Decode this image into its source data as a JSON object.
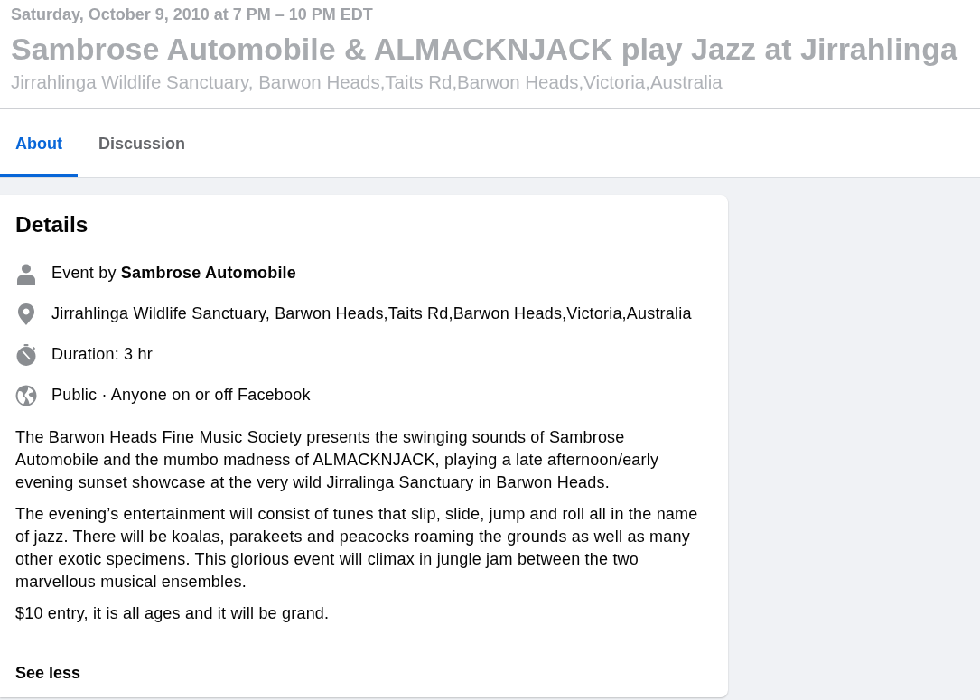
{
  "event_header": {
    "date": "Saturday, October 9, 2010 at 7 PM – 10 PM EDT",
    "title": "Sambrose Automobile & ALMACKNJACK play Jazz at Jirrahlinga",
    "location": "Jirrahlinga Wildlife Sanctuary, Barwon Heads,Taits Rd,Barwon Heads,Victoria,Australia"
  },
  "tabs": [
    {
      "label": "About",
      "selected": true
    },
    {
      "label": "Discussion",
      "selected": false
    }
  ],
  "details": {
    "heading": "Details",
    "items": [
      {
        "kind": "host",
        "text": "Event by **Sambrose Automobile**"
      },
      {
        "kind": "location",
        "text": "Jirrahlinga Wildlife Sanctuary, Barwon Heads,Taits Rd,Barwon Heads,Victoria,Australia"
      },
      {
        "kind": "duration",
        "text": "Duration: 3 hr"
      },
      {
        "kind": "privacy",
        "text": "Public · Anyone on or off Facebook"
      }
    ],
    "description": [
      "The Barwon Heads Fine Music Society presents the swinging sounds of Sambrose Automobile and the mumbo madness of ALMACKNJACK, playing a late afternoon/early evening sunset showcase at the very wild Jirralinga Sanctuary in Barwon Heads.",
      "The evening’s entertainment will consist of tunes that slip, slide, jump and roll all in the name of jazz. There will be koalas, parakeets and peacocks roaming the grounds as well as many other exotic specimens. This glorious event will climax in jungle jam between the two marvellous musical ensembles.",
      "$10 entry, it is all ages and it will be grand."
    ],
    "see_less": "See less"
  }
}
